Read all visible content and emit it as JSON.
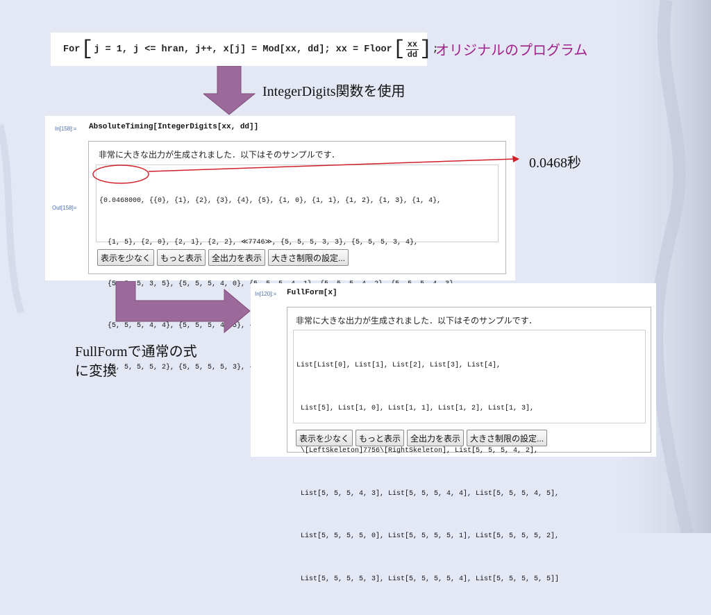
{
  "original": {
    "code_prefix": "For",
    "code_body": "j = 1, j <= hran, j++, x[j] = Mod[xx, dd]; xx = Floor",
    "frac_num": "xx",
    "frac_den": "dd",
    "code_suffix": ";",
    "label": "オリジナルのプログラム"
  },
  "caption_integerdigits": "IntegerDigits関数を使用",
  "caption_timing": "0.0468秒",
  "caption_fullform_line1": "FullFormで通常の式",
  "caption_fullform_line2": "に変換",
  "colors": {
    "arrow": "#9c6a9a",
    "label_accent": "#a0208c",
    "highlight": "#d0202a",
    "background": "#e4e8f4"
  },
  "panel1": {
    "in_label": "In[158]:=",
    "input": "AbsoluteTiming[IntegerDigits[xx, dd]]",
    "out_label": "Out[158]=",
    "message": "非常に大きな出力が生成されました．以下はそのサンプルです．",
    "lines": [
      "{0.0468000, {{0}, {1}, {2}, {3}, {4}, {5}, {1, 0}, {1, 1}, {1, 2}, {1, 3}, {1, 4},",
      "  {1, 5}, {2, 0}, {2, 1}, {2, 2}, ≪7746≫, {5, 5, 5, 3, 3}, {5, 5, 5, 3, 4},",
      "  {5, 5, 5, 3, 5}, {5, 5, 5, 4, 0}, {5, 5, 5, 4, 1}, {5, 5, 5, 4, 2}, {5, 5, 5, 4, 3},",
      "  {5, 5, 5, 4, 4}, {5, 5, 5, 4, 5}, {5, 5, 5, 5, 0}, {5, 5, 5, 5, 1},",
      "  {5, 5, 5, 5, 2}, {5, 5, 5, 5, 3}, {5, 5, 5, 5, 4}, {5, 5, 5, 5, 5}}}"
    ],
    "buttons": [
      "表示を少なく",
      "もっと表示",
      "全出力を表示",
      "大きさ制限の設定..."
    ]
  },
  "panel2": {
    "in_label": "In[120]:=",
    "input": "FullForm[x]",
    "message": "非常に大きな出力が生成されました．以下はそのサンプルです．",
    "lines": [
      "List[List[0], List[1], List[2], List[3], List[4],",
      " List[5], List[1, 0], List[1, 1], List[1, 2], List[1, 3],",
      " \\[LeftSkeleton]7756\\[RightSkeleton], List[5, 5, 5, 4, 2],",
      " List[5, 5, 5, 4, 3], List[5, 5, 5, 4, 4], List[5, 5, 5, 4, 5],",
      " List[5, 5, 5, 5, 0], List[5, 5, 5, 5, 1], List[5, 5, 5, 5, 2],",
      " List[5, 5, 5, 5, 3], List[5, 5, 5, 5, 4], List[5, 5, 5, 5, 5]]"
    ],
    "buttons": [
      "表示を少なく",
      "もっと表示",
      "全出力を表示",
      "大きさ制限の設定..."
    ]
  }
}
